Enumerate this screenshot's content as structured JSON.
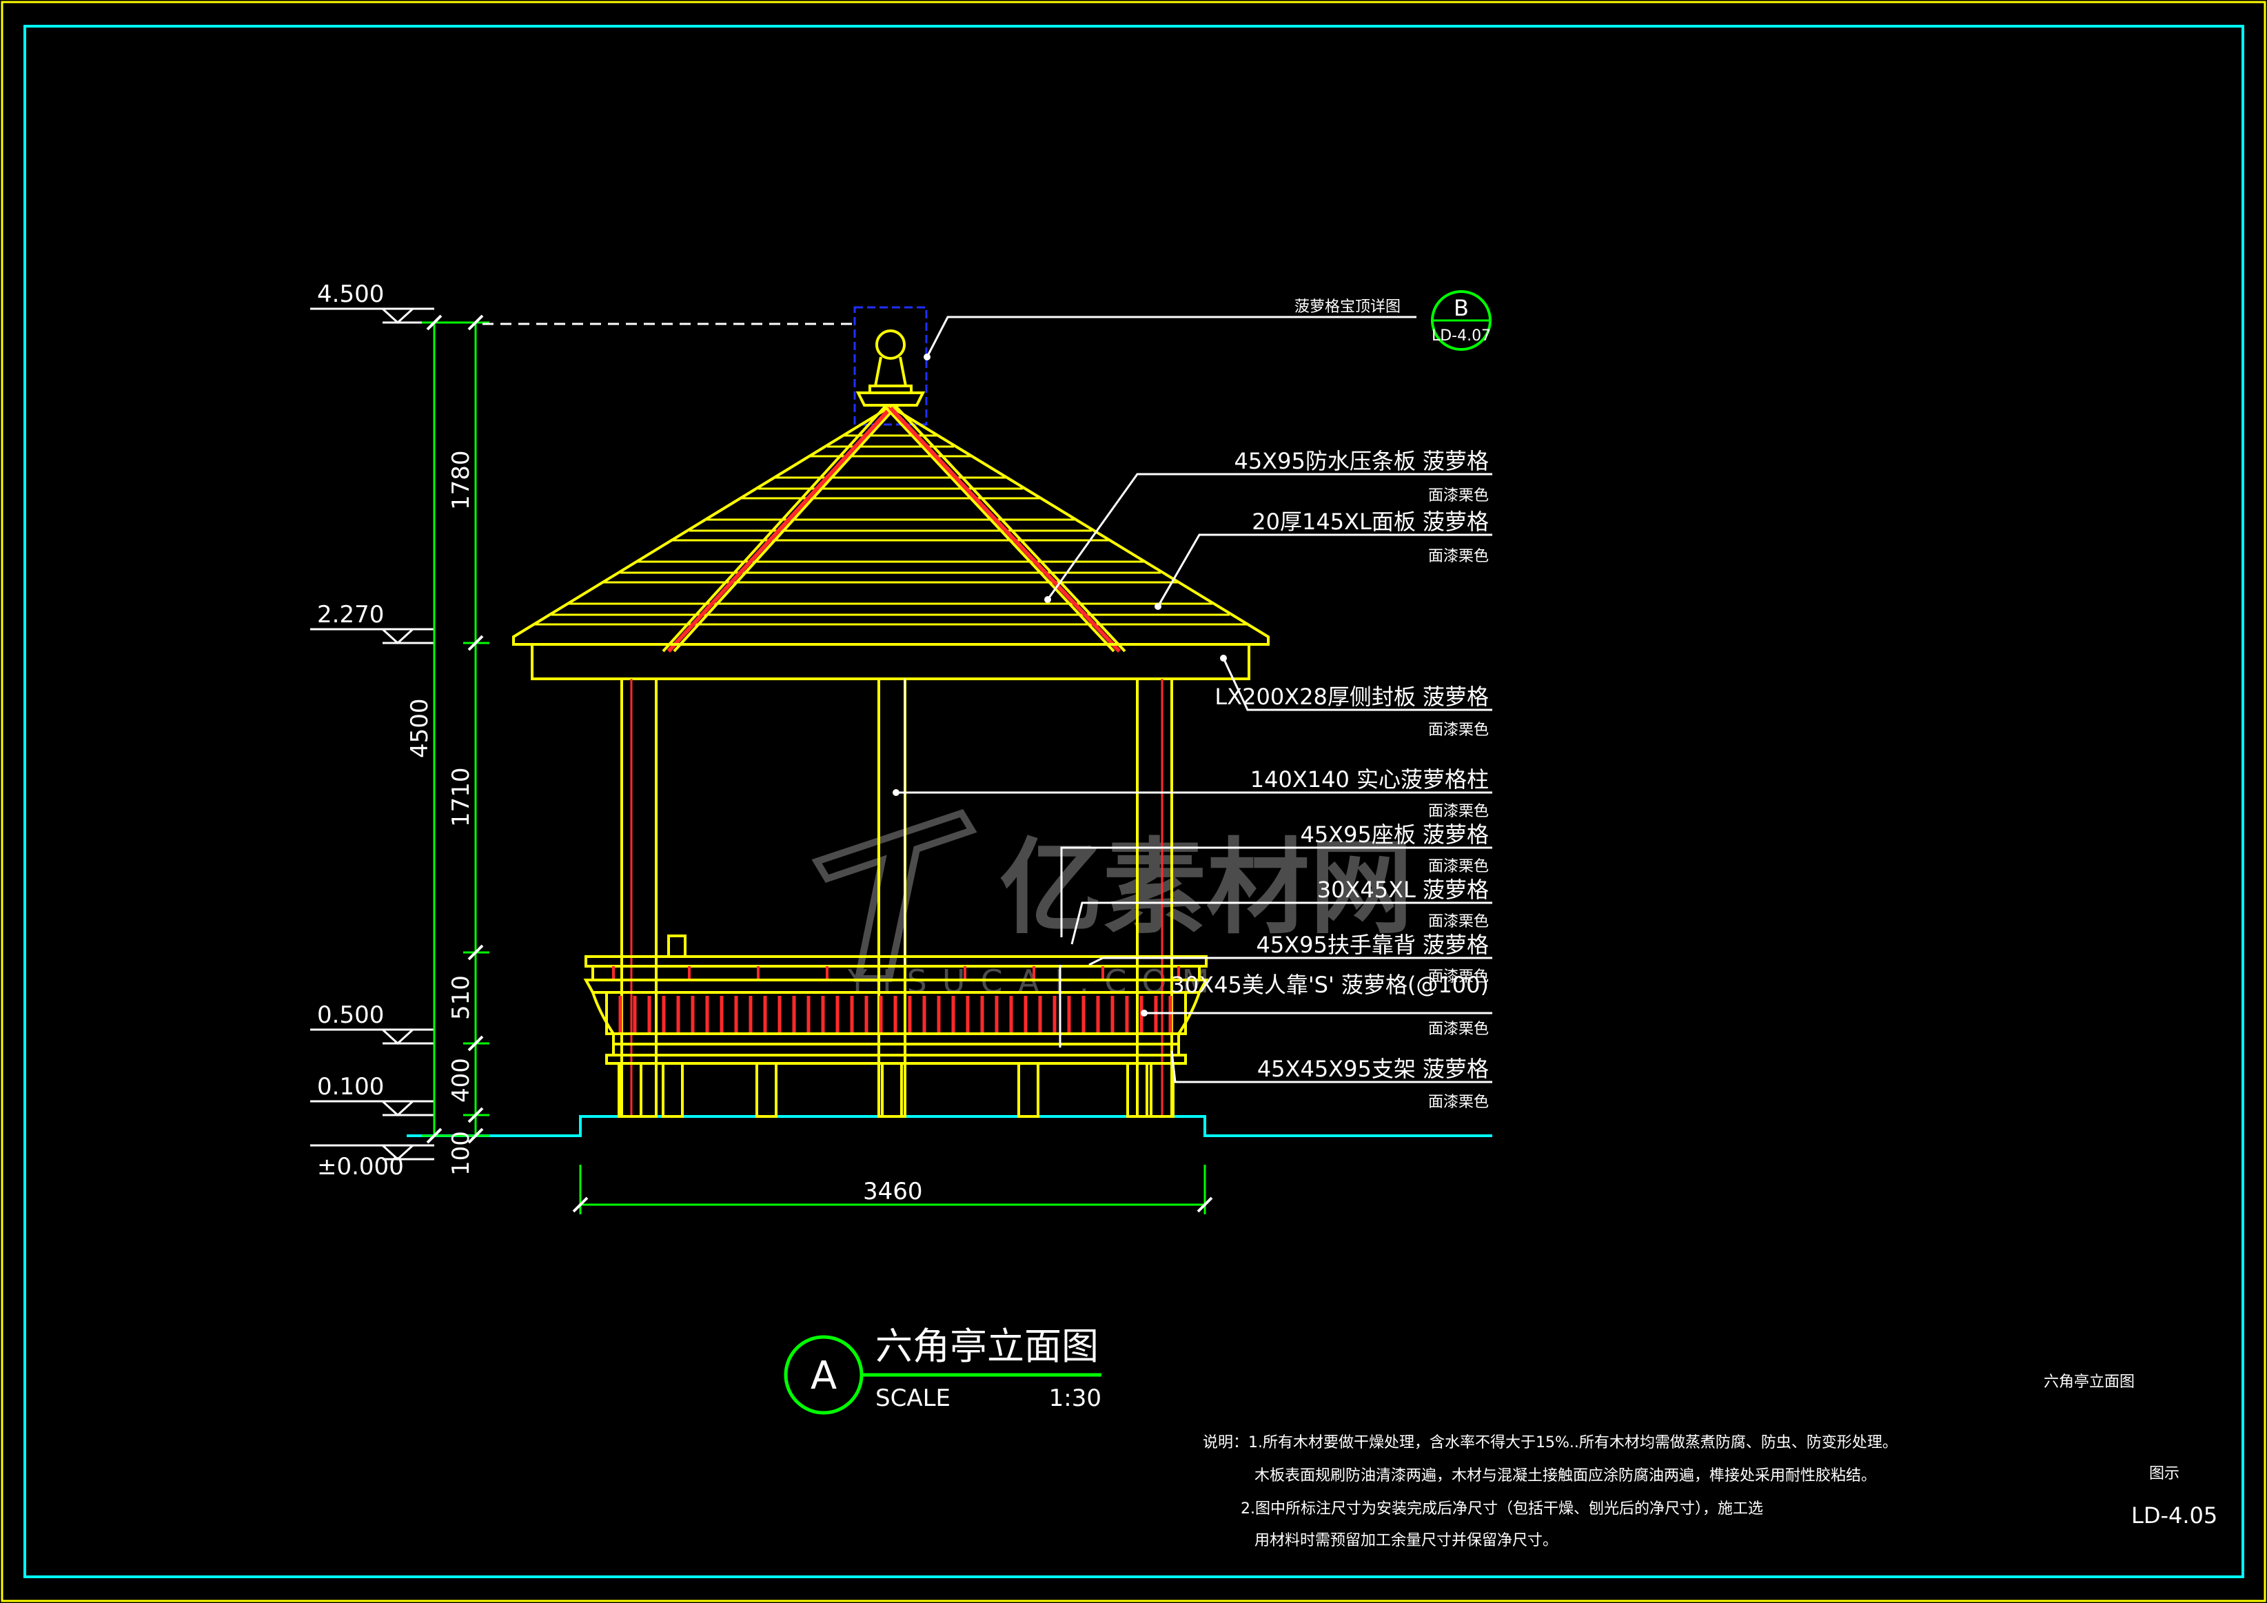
{
  "colors": {
    "background": "#000000",
    "frame": "#00ffff",
    "outer_border": "#ffff00",
    "structure": "#ffff00",
    "dimension": "#00ff00",
    "text": "#ffffff",
    "accent_red": "#ff2a2a",
    "finial_box": "#2030ff",
    "watermark": "#7a7a7a"
  },
  "levels": [
    "4.500",
    "2.270",
    "0.500",
    "0.100",
    "±0.000"
  ],
  "dimensions": {
    "overall_height": "4500",
    "segments": [
      "1780",
      "1710",
      "510",
      "400",
      "100"
    ],
    "width": "3460"
  },
  "callouts": [
    {
      "main": "菠萝格宝顶详图",
      "sub": ""
    },
    {
      "main": "45X95防水压条板  菠萝格",
      "sub": "面漆栗色"
    },
    {
      "main": "20厚145XL面板  菠萝格",
      "sub": "面漆栗色"
    },
    {
      "main": "LX200X28厚侧封板  菠萝格",
      "sub": "面漆栗色"
    },
    {
      "main": "140X140  实心菠萝格柱",
      "sub": "面漆栗色"
    },
    {
      "main": "45X95座板  菠萝格",
      "sub": "面漆栗色"
    },
    {
      "main": "30X45XL  菠萝格",
      "sub": "面漆栗色"
    },
    {
      "main": "45X95扶手靠背  菠萝格",
      "sub": "面漆栗色"
    },
    {
      "main": "30X45美人靠'S' 菠萝格(@100)",
      "sub": "面漆栗色"
    },
    {
      "main": "45X45X95支架  菠萝格",
      "sub": "面漆栗色"
    }
  ],
  "detail_ref": {
    "letter": "B",
    "sheet": "LD-4.07"
  },
  "title_block": {
    "letter": "A",
    "title": "六角亭立面图",
    "scale_label": "SCALE",
    "scale_value": "1:30"
  },
  "notes": [
    "说明：1.所有木材要做干燥处理，含水率不得大于15%..所有木材均需做蒸煮防腐、防虫、防变形处理。",
    "木板表面规刷防油清漆两遍，木材与混凝土接触面应涂防腐油两遍，榫接处采用耐性胶粘结。",
    "2.图中所标注尺寸为安装完成后净尺寸（包括干燥、刨光后的净尺寸），施工选",
    "用材料时需预留加工余量尺寸并保留净尺寸。"
  ],
  "sheet_title": "六角亭立面图",
  "sheet_label": "图示",
  "sheet_number": "LD-4.05",
  "watermark": {
    "main": "亿素材网",
    "sub": "YISUCAI.COM"
  }
}
